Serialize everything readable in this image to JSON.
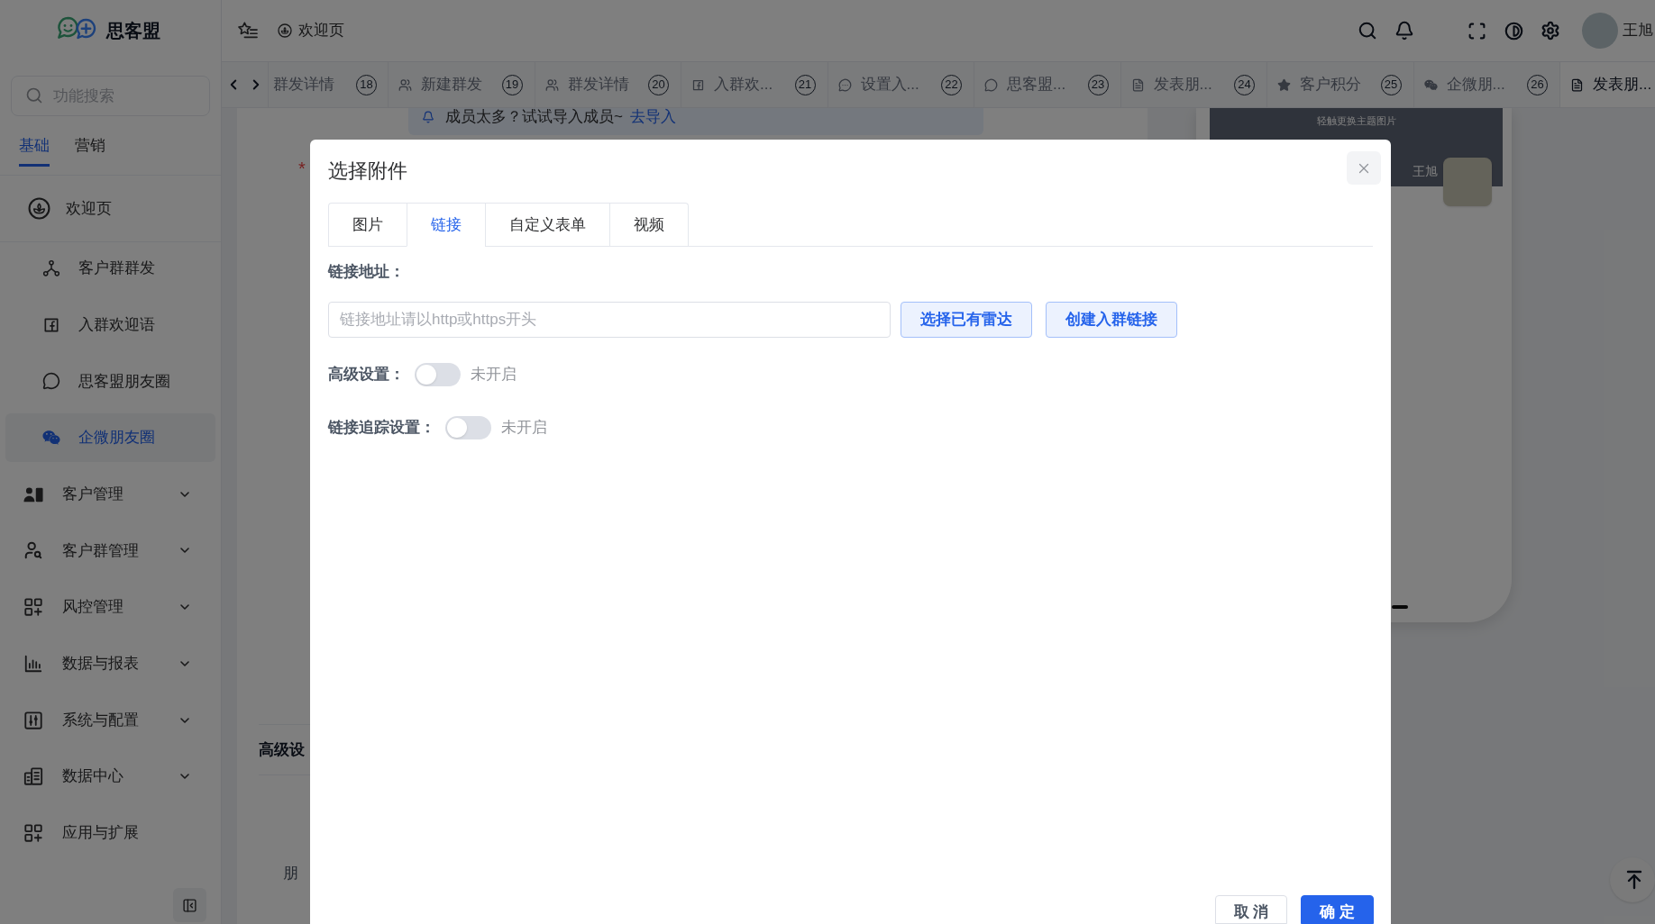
{
  "sidebar": {
    "logo": "思客盟",
    "search": {
      "placeholder": "功能搜索"
    },
    "tabs": [
      {
        "label": "基础",
        "selected": true
      },
      {
        "label": "营销",
        "selected": false
      }
    ],
    "home": {
      "label": "欢迎页"
    },
    "shortcuts": [
      {
        "label": "客户群群发",
        "selected": false
      },
      {
        "label": "入群欢迎语",
        "selected": false
      },
      {
        "label": "思客盟朋友圈",
        "selected": false
      },
      {
        "label": "企微朋友圈",
        "selected": true
      }
    ],
    "menu": [
      {
        "label": "客户管理",
        "kind": "group",
        "expanded": false
      },
      {
        "label": "客户群管理",
        "kind": "group",
        "expanded": false
      },
      {
        "label": "风控管理",
        "kind": "group",
        "expanded": false
      },
      {
        "label": "数据与报表",
        "kind": "group",
        "expanded": false
      },
      {
        "label": "系统与配置",
        "kind": "group",
        "expanded": false
      },
      {
        "label": "数据中心",
        "kind": "group",
        "expanded": false
      },
      {
        "label": "应用与扩展",
        "kind": "link"
      }
    ]
  },
  "header": {
    "breadcrumb": "欢迎页",
    "user": "王旭"
  },
  "tabs": [
    {
      "label": "群发详情",
      "badge": "18",
      "selected": false
    },
    {
      "label": "新建群发",
      "badge": "19",
      "selected": false
    },
    {
      "label": "群发详情",
      "badge": "20",
      "selected": false
    },
    {
      "label": "入群欢...",
      "badge": "21",
      "selected": false
    },
    {
      "label": "设置入...",
      "badge": "22",
      "selected": false
    },
    {
      "label": "思客盟...",
      "badge": "23",
      "selected": false
    },
    {
      "label": "发表朋...",
      "badge": "24",
      "selected": false
    },
    {
      "label": "客户积分",
      "badge": "25",
      "selected": false
    },
    {
      "label": "企微朋...",
      "badge": "26",
      "selected": false
    },
    {
      "label": "发表朋...",
      "selected": true
    }
  ],
  "page": {
    "notice": {
      "text": "成员太多？试试导入成员~",
      "link": "去导入"
    },
    "required_mark": "*",
    "section_title": "高级设",
    "field_label": "朋"
  },
  "phone_preview": {
    "cover_hint": "轻触更换主题图片",
    "name": "王旭"
  },
  "modal": {
    "title": "选择附件",
    "tabs": [
      {
        "label": "图片",
        "selected": false
      },
      {
        "label": "链接",
        "selected": true
      },
      {
        "label": "自定义表单",
        "selected": false
      },
      {
        "label": "视频",
        "selected": false
      }
    ],
    "link_field": {
      "label": "链接地址：",
      "placeholder": "链接地址请以http或https开头"
    },
    "actions": [
      "选择已有雷达",
      "创建入群链接"
    ],
    "settings": [
      {
        "label": "高级设置：",
        "on": false,
        "status": "未开启"
      },
      {
        "label": "链接追踪设置：",
        "on": false,
        "status": "未开启"
      }
    ],
    "footer": [
      {
        "label": "取 消",
        "kind": "default"
      },
      {
        "label": "确 定",
        "kind": "primary"
      }
    ]
  }
}
